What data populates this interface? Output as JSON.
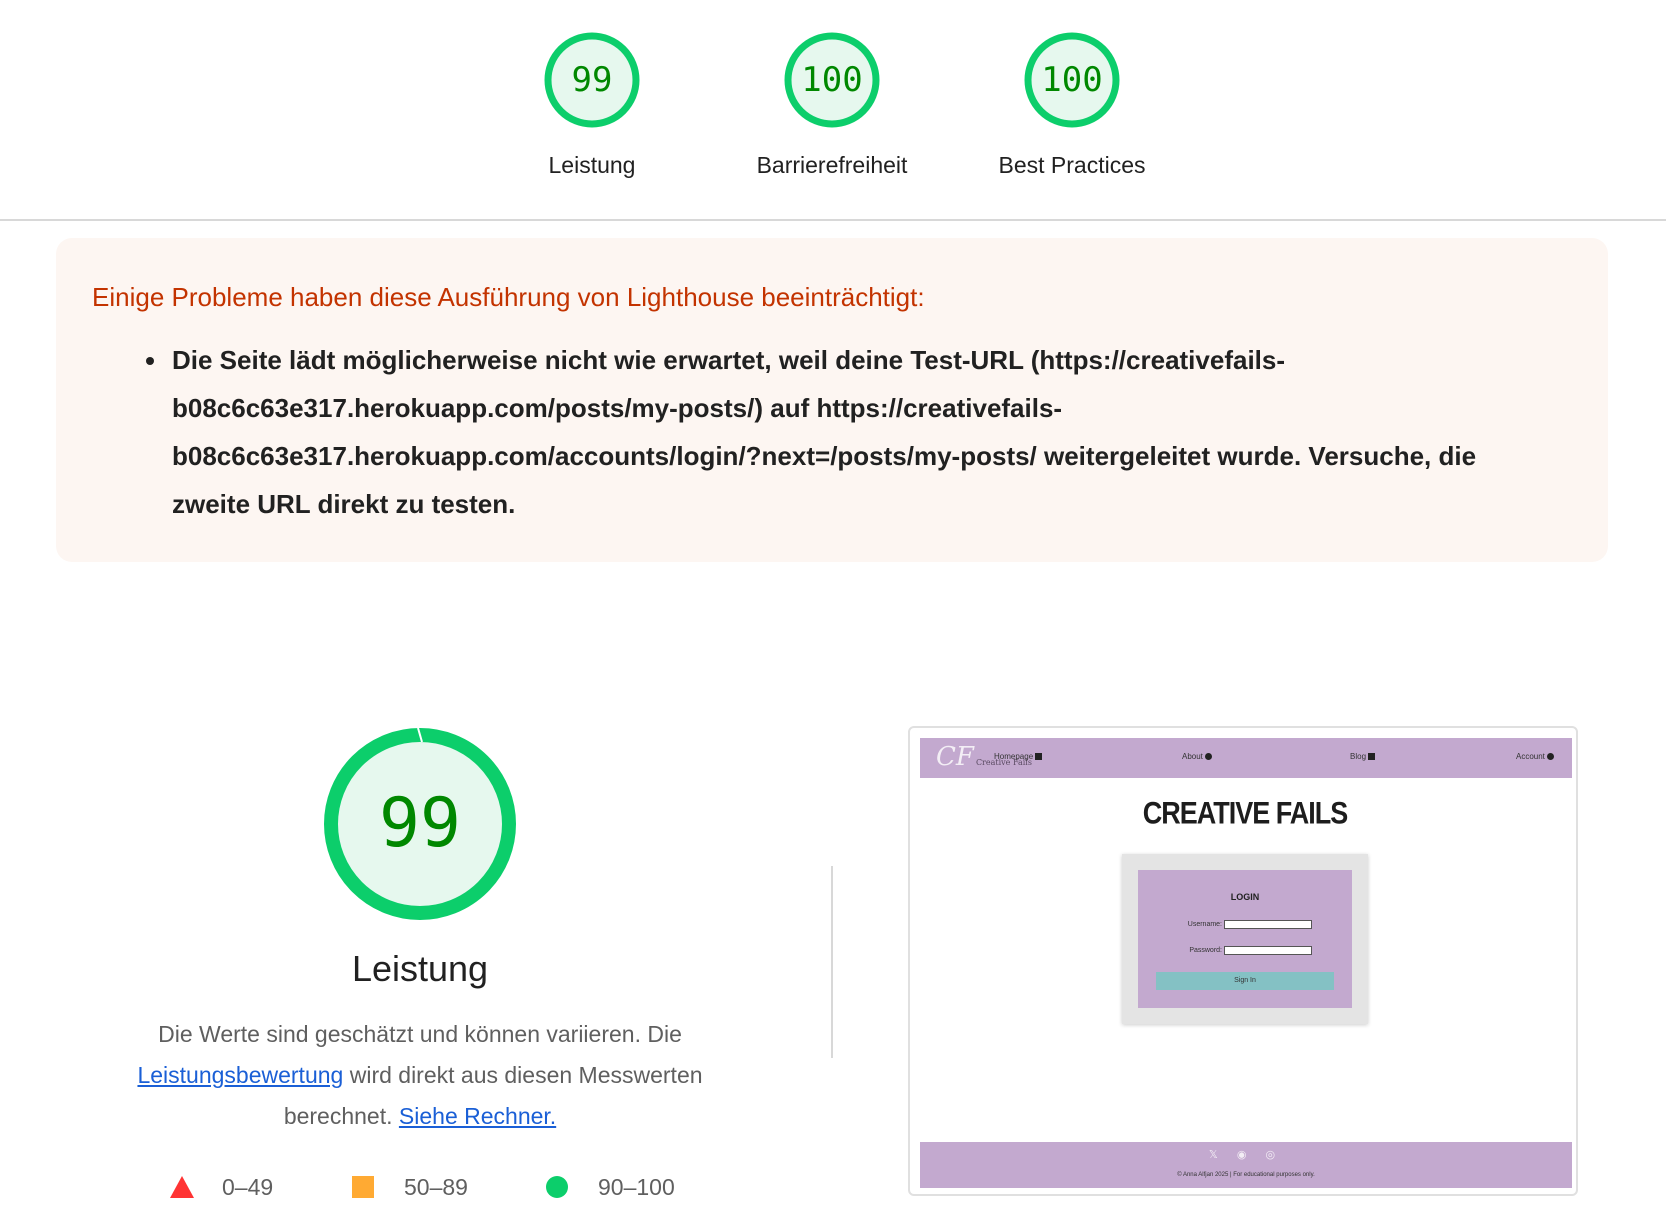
{
  "top_gauges": [
    {
      "score": "99",
      "label": "Leistung",
      "value": 99
    },
    {
      "score": "100",
      "label": "Barrierefreiheit",
      "value": 100
    },
    {
      "score": "100",
      "label": "Best Practices",
      "value": 100
    }
  ],
  "warning": {
    "title": "Einige Probleme haben diese Ausführung von Lighthouse beeinträchtigt:",
    "items": [
      "Die Seite lädt möglicherweise nicht wie erwartet, weil deine Test-URL (https://creativefails-b08c6c63e317.herokuapp.com/posts/my-posts/) auf https://creativefails-b08c6c63e317.herokuapp.com/accounts/login/?next=/posts/my-posts/ weitergeleitet wurde. Versuche, die zweite URL direkt zu testen."
    ]
  },
  "performance": {
    "score": "99",
    "value": 99,
    "title": "Leistung",
    "desc_part1": "Die Werte sind geschätzt und können variieren. Die ",
    "link1": "Leistungsbewertung",
    "desc_part2": " wird direkt aus diesen Messwerten berechnet. ",
    "link2": "Siehe Rechner."
  },
  "legend": [
    {
      "range": "0–49",
      "shape": "triangle",
      "color": "#ff3333"
    },
    {
      "range": "50–89",
      "shape": "square",
      "color": "#ffaa33"
    },
    {
      "range": "90–100",
      "shape": "circle",
      "color": "#0cce6b"
    }
  ],
  "colors": {
    "pass": "#0cce6b",
    "pass_text": "#008800",
    "pass_fill": "#e6f8ee",
    "warning_title": "#c33300"
  },
  "thumbnail": {
    "logo": "CF",
    "logo_small": "Creative Fails",
    "nav": [
      {
        "label": "Homepage",
        "icon": "home-icon"
      },
      {
        "label": "About",
        "icon": "info-icon"
      },
      {
        "label": "Blog",
        "icon": "blog-icon"
      },
      {
        "label": "Account",
        "icon": "user-icon"
      }
    ],
    "heading": "CREATIVE FAILS",
    "form_title": "LOGIN",
    "username_label": "Username:",
    "password_label": "Password:",
    "button": "Sign In",
    "socials": "𝕏 ◉ ◎",
    "copyright": "© Anna Alfjan 2025 | For educational purposes only."
  }
}
